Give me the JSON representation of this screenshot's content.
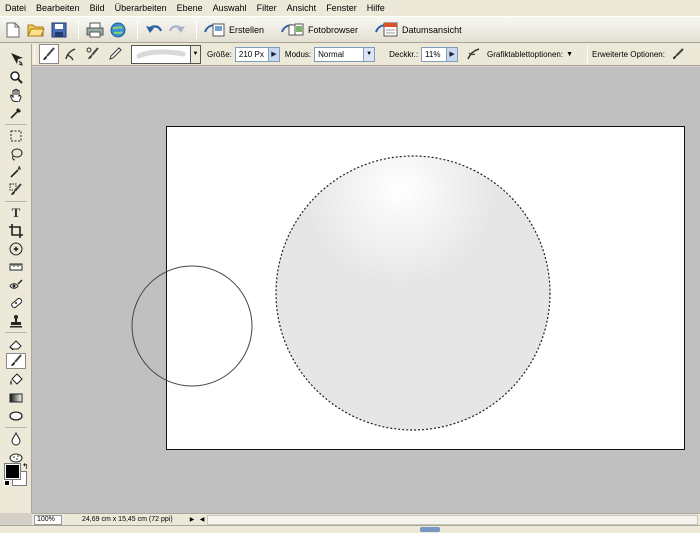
{
  "menu": [
    "Datei",
    "Bearbeiten",
    "Bild",
    "Überarbeiten",
    "Ebene",
    "Auswahl",
    "Filter",
    "Ansicht",
    "Fenster",
    "Hilfe"
  ],
  "shortcuts": {
    "icons": [
      "new-file-icon",
      "open-folder-icon",
      "save-icon",
      "print-icon",
      "online-services-icon",
      "undo-icon",
      "redo-icon"
    ],
    "workspace_buttons": [
      {
        "label": "Erstellen",
        "icon": "create-icon"
      },
      {
        "label": "Fotobrowser",
        "icon": "photo-browser-icon"
      },
      {
        "label": "Datumsansicht",
        "icon": "date-view-icon"
      }
    ]
  },
  "options": {
    "size_label": "Größe:",
    "size_value": "210 Px",
    "mode_label": "Modus:",
    "mode_value": "Normal",
    "opacity_label": "Deckkr.:",
    "opacity_value": "11%",
    "tablet_label": "Grafiktablettoptionen:",
    "advanced_label": "Erweiterte Optionen:"
  },
  "toolbox": {
    "tools": [
      "move",
      "zoom",
      "hand",
      "eyedropper",
      "marquee",
      "lasso",
      "magic-wand",
      "selection-brush",
      "type",
      "crop",
      "cookie-cutter",
      "straighten",
      "red-eye",
      "spot-healing",
      "clone-stamp",
      "eraser",
      "brush",
      "paint-bucket",
      "gradient",
      "shape",
      "blur",
      "sponge"
    ],
    "active_tool": "brush",
    "foreground_color": "#000000",
    "background_color": "#ffffff"
  },
  "status": {
    "zoom": "100%",
    "doc_size": "24,69 cm x 15,45 cm (72 ppi)"
  }
}
